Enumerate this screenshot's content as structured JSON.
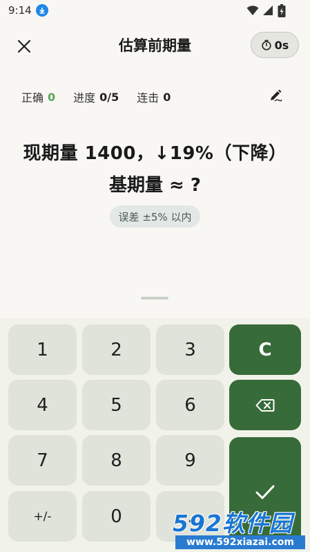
{
  "status_bar": {
    "time": "9:14"
  },
  "header": {
    "title": "估算前期量",
    "timer": "0s"
  },
  "stats": [
    {
      "label": "正确",
      "value": "0"
    },
    {
      "label": "进度",
      "value": "0/5"
    },
    {
      "label": "连击",
      "value": "0"
    }
  ],
  "question": {
    "line1": "现期量 1400，↓19%（下降）",
    "line2": "基期量 ≈ ?",
    "tolerance": "误差 ±5% 以内"
  },
  "keypad": {
    "keys": [
      "1",
      "2",
      "3",
      "4",
      "5",
      "6",
      "7",
      "8",
      "9",
      "+/-",
      "0",
      "."
    ],
    "clear_label": "C"
  },
  "watermark": {
    "brand": "592软件园",
    "url": "www.592xiazai.com"
  },
  "colors": {
    "accent_green": "#386b3a",
    "correct_green": "#5aa65a",
    "download_blue": "#1e88e5"
  }
}
